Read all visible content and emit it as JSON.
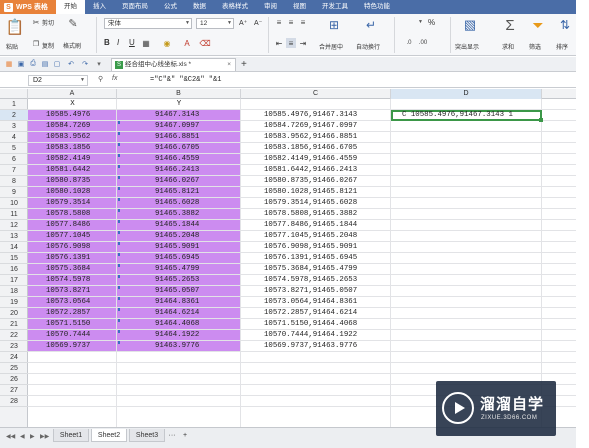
{
  "app": {
    "name": "WPS 表格",
    "icon": "wps-logo-icon"
  },
  "menu": {
    "items": [
      "开始",
      "插入",
      "页面布局",
      "公式",
      "数据",
      "表格样式",
      "审阅",
      "视图",
      "开发工具",
      "特色功能"
    ],
    "active": 0
  },
  "ribbon": {
    "paste": "粘贴",
    "cut": "剪切",
    "copy": "复制",
    "format_painter": "格式刷",
    "font_name": "宋体",
    "font_size": "12",
    "font_grow": "A⁺",
    "font_shrink": "A⁻",
    "bold": "B",
    "italic": "I",
    "underline": "U",
    "merge": "合并居中",
    "wrap": "自动换行",
    "number_format": "%",
    "highlight": "突出显示",
    "sum": "求和",
    "filter": "筛选",
    "sort": "排序"
  },
  "document": {
    "tab_title": "经合组中心线坐标.xls *",
    "close": "×",
    "new_tab": "+"
  },
  "formula_bar": {
    "name_box": "D2",
    "fx": "fx",
    "formula": "=\"C\"&\" \"&C2&\" \"&1"
  },
  "sheet": {
    "columns": [
      "A",
      "B",
      "C",
      "D"
    ],
    "active_column": "D",
    "rows": [
      "1",
      "2",
      "3",
      "4",
      "5",
      "6",
      "7",
      "8",
      "9",
      "10",
      "11",
      "12",
      "13",
      "14",
      "15",
      "16",
      "17",
      "18",
      "19",
      "20",
      "21",
      "22",
      "23",
      "24",
      "25",
      "26",
      "27",
      "28"
    ],
    "active_row": "2",
    "header_row": [
      "X",
      "Y"
    ],
    "x_values": [
      "10585.4976",
      "10584.7269",
      "10583.9562",
      "10583.1856",
      "10582.4149",
      "10581.6442",
      "10580.8735",
      "10580.1028",
      "10579.3514",
      "10578.5808",
      "10577.8486",
      "10577.1045",
      "10576.9098",
      "10576.1391",
      "10575.3684",
      "10574.5978",
      "10573.8271",
      "10573.0564",
      "10572.2857",
      "10571.5150",
      "10570.7444",
      "10569.9737"
    ],
    "y_values": [
      "91467.3143",
      "91467.0997",
      "91466.8851",
      "91466.6705",
      "91466.4559",
      "91466.2413",
      "91466.0267",
      "91465.8121",
      "91465.6028",
      "91465.3882",
      "91465.1844",
      "91465.2048",
      "91465.9091",
      "91465.6945",
      "91465.4799",
      "91465.2653",
      "91465.0507",
      "91464.8361",
      "91464.6214",
      "91464.4068",
      "91464.1922",
      "91463.9776"
    ],
    "c_values": [
      "10585.4976,91467.3143",
      "10584.7269,91467.0997",
      "10583.9562,91466.8851",
      "10583.1856,91466.6705",
      "10582.4149,91466.4559",
      "10581.6442,91466.2413",
      "10580.8735,91466.0267",
      "10580.1028,91465.8121",
      "10579.3514,91465.6028",
      "10578.5808,91465.3882",
      "10577.8486,91465.1844",
      "10577.1045,91465.2048",
      "10576.9098,91465.9091",
      "10576.1391,91465.6945",
      "10575.3684,91465.4799",
      "10574.5978,91465.2653",
      "10573.8271,91465.0507",
      "10573.0564,91464.8361",
      "10572.2857,91464.6214",
      "10571.5150,91464.4068",
      "10570.7444,91464.1922",
      "10569.9737,91463.9776"
    ],
    "d2_value": "C 10585.4976,91467.3143 1",
    "highlight_color": "#cc8cf0"
  },
  "sheet_tabs": {
    "tabs": [
      "Sheet1",
      "Sheet2",
      "Sheet3"
    ],
    "active": "Sheet2",
    "more": "···",
    "add": "+"
  },
  "watermark": {
    "title": "溜溜自学",
    "url": "ZIXUE.3D66.COM"
  }
}
